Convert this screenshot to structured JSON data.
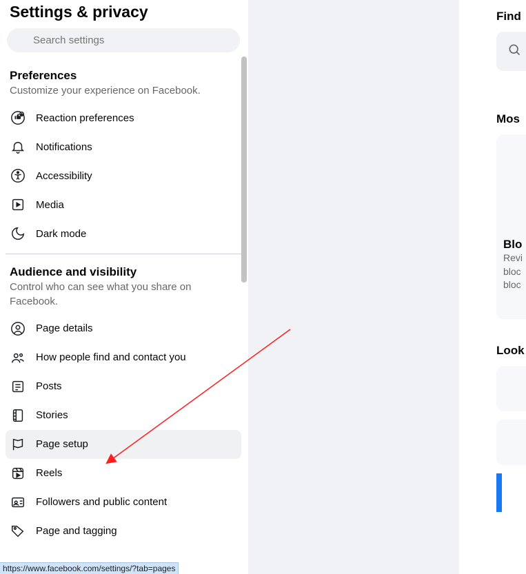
{
  "page": {
    "title": "Settings & privacy"
  },
  "search": {
    "placeholder": "Search settings"
  },
  "sections": {
    "preferences": {
      "title": "Preferences",
      "sub": "Customize your experience on Facebook.",
      "items": [
        {
          "label": "Reaction preferences",
          "icon": "thumb"
        },
        {
          "label": "Notifications",
          "icon": "bell"
        },
        {
          "label": "Accessibility",
          "icon": "access"
        },
        {
          "label": "Media",
          "icon": "media"
        },
        {
          "label": "Dark mode",
          "icon": "moon"
        }
      ]
    },
    "audience": {
      "title": "Audience and visibility",
      "sub": "Control who can see what you share on Facebook.",
      "items": [
        {
          "label": "Page details",
          "icon": "user"
        },
        {
          "label": "How people find and contact you",
          "icon": "people"
        },
        {
          "label": "Posts",
          "icon": "posts"
        },
        {
          "label": "Stories",
          "icon": "stories"
        },
        {
          "label": "Page setup",
          "icon": "flag",
          "active": true
        },
        {
          "label": "Reels",
          "icon": "reels"
        },
        {
          "label": "Followers and public content",
          "icon": "followers"
        },
        {
          "label": "Page and tagging",
          "icon": "tag"
        }
      ]
    }
  },
  "right": {
    "find_heading": "Find",
    "most_heading": "Mos",
    "look_heading": "Look",
    "blocking": {
      "title": "Blo",
      "line1": "Revi",
      "line2": "bloc",
      "line3": "bloc"
    }
  },
  "status_url": "https://www.facebook.com/settings/?tab=pages"
}
